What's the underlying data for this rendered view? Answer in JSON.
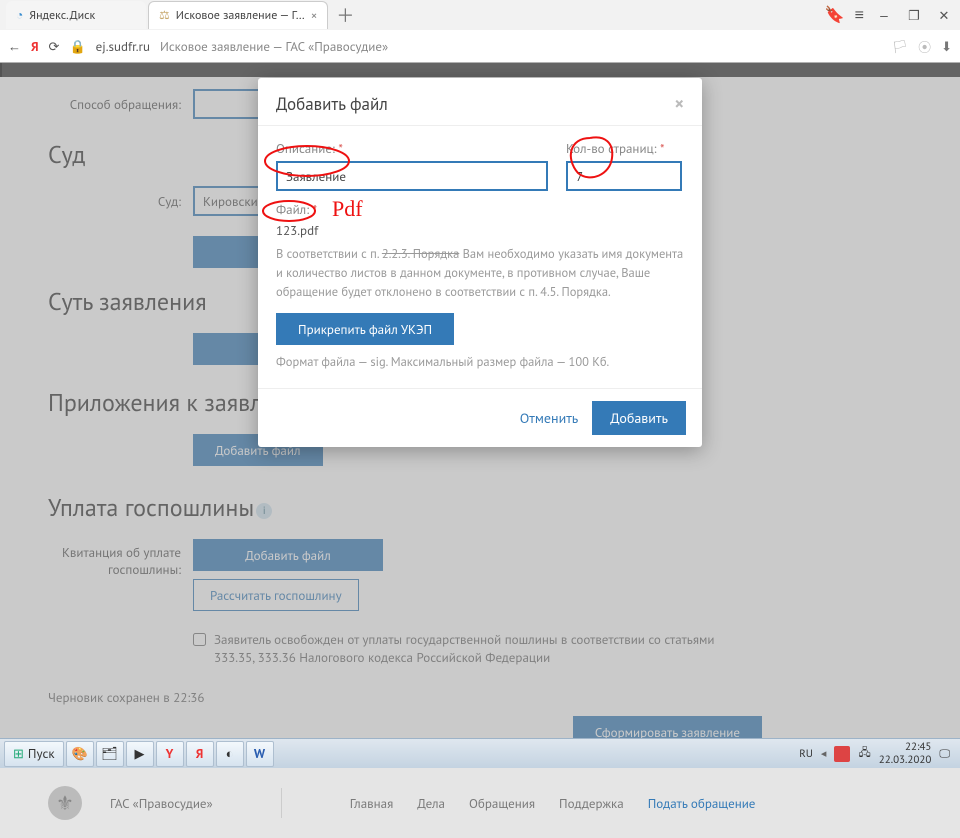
{
  "browser": {
    "tab1": "Яндекс.Диск",
    "tab2": "Исковое заявление — Г…",
    "url_host": "ej.sudfr.ru",
    "url_path": "  Исковое заявление — ГАС «Правосудие»"
  },
  "form": {
    "method_label": "Способ обращения:",
    "select_placeholder": "",
    "court_heading": "Суд",
    "court_label": "Суд:",
    "court_value": "Кировский",
    "essence_heading": "Суть заявления",
    "attachments_heading": "Приложения к заявлению",
    "add_file": "Добавить файл",
    "fee_heading": "Уплата госпошлины",
    "receipt_label": "Квитанция об уплате госпошлины:",
    "calc_fee": "Рассчитать госпошлину",
    "exempt_text": "Заявитель освобожден от уплаты государственной пошлины в соответствии со статьями 333.35, 333.36 Налогового кодекса Российской Федерации",
    "draft_saved": "Черновик сохранен в 22:36",
    "submit": "Сформировать заявление"
  },
  "modal": {
    "title": "Добавить файл",
    "desc_label": "Описание:",
    "desc_value": "Заявление",
    "pages_label": "Кол-во страниц:",
    "pages_value": "7",
    "file_label": "Файл:",
    "file_name": "123.pdf",
    "help_line1_prefix": "В соответствии с п. ",
    "help_line1_struck": "2.2.3. Порядка",
    "help_line1_rest": " Вам необходимо указать имя документа и количество листов в данном документе, в противном случае, Ваше обращение будет отклонено в соответствии с п. 4.5. Порядка.",
    "attach_sig": "Прикрепить файл УКЭП",
    "sig_help": "Формат файла — sig. Максимальный размер файла — 100 Кб.",
    "cancel": "Отменить",
    "add": "Добавить"
  },
  "annotations": {
    "pdf_handwritten": "Pdf"
  },
  "footer": {
    "brand": "ГАС «Правосудие»",
    "main": "Главная",
    "cases": "Дела",
    "appeals": "Обращения",
    "support": "Поддержка",
    "submit_appeal": "Подать обращение"
  },
  "taskbar": {
    "start": "Пуск",
    "lang": "RU",
    "time": "22:45",
    "date": "22.03.2020"
  }
}
